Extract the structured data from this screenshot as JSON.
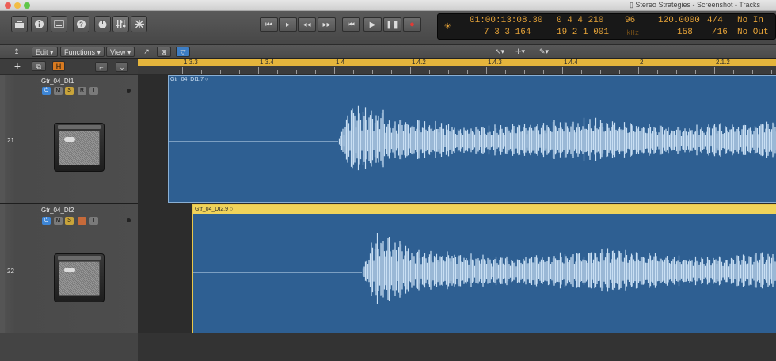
{
  "window": {
    "title": "Stereo Strategies - Screenshot - Tracks"
  },
  "transport_display": {
    "time": "01:00:13:08.30",
    "bars": "0  4  4  210",
    "bars2": "7  3  3  164",
    "tempo_hundreds": "96",
    "tempo": "120.0000",
    "signature": "4/4",
    "midi_in": "No In",
    "locator": "19  2  1  001",
    "khz": "kHz",
    "bpm_sub": "158",
    "division": "/16",
    "midi_out": "No Out"
  },
  "toolbar": {
    "edit_label": "Edit",
    "functions_label": "Functions",
    "view_label": "View"
  },
  "ruler": {
    "marks": [
      {
        "label": "1.3.3",
        "bar": 0
      },
      {
        "label": "1.3.4",
        "bar": 1
      },
      {
        "label": "1.4",
        "bar": 2
      },
      {
        "label": "1.4.2",
        "bar": 3
      },
      {
        "label": "1.4.3",
        "bar": 4
      },
      {
        "label": "1.4.4",
        "bar": 5
      },
      {
        "label": "2",
        "bar": 6
      },
      {
        "label": "2.1.2",
        "bar": 7
      }
    ]
  },
  "tracks": [
    {
      "number": "21",
      "name": "Gtr_04_DI1",
      "region_name": "Gtr_04_DI1.7",
      "selected": false
    },
    {
      "number": "22",
      "name": "Gtr_04_DI2",
      "region_name": "Gtr_04_DI2.9",
      "selected": true
    }
  ],
  "track_buttons": {
    "on": "⏻",
    "mute": "M",
    "solo": "S",
    "record": "R",
    "input": "I"
  },
  "colors": {
    "region_fill": "#2e5f92",
    "waveform": "#c9dff3",
    "selected_header": "#f0d35a",
    "lcd_text": "#e6a338",
    "cycle": "#e5b53c"
  },
  "icons": {
    "library": "library-icon",
    "inspector": "info-icon",
    "toolbar": "toolbar-icon",
    "help": "help-icon",
    "smart_controls": "smart-controls-icon",
    "mixer": "mixer-icon",
    "editors": "editors-icon"
  }
}
